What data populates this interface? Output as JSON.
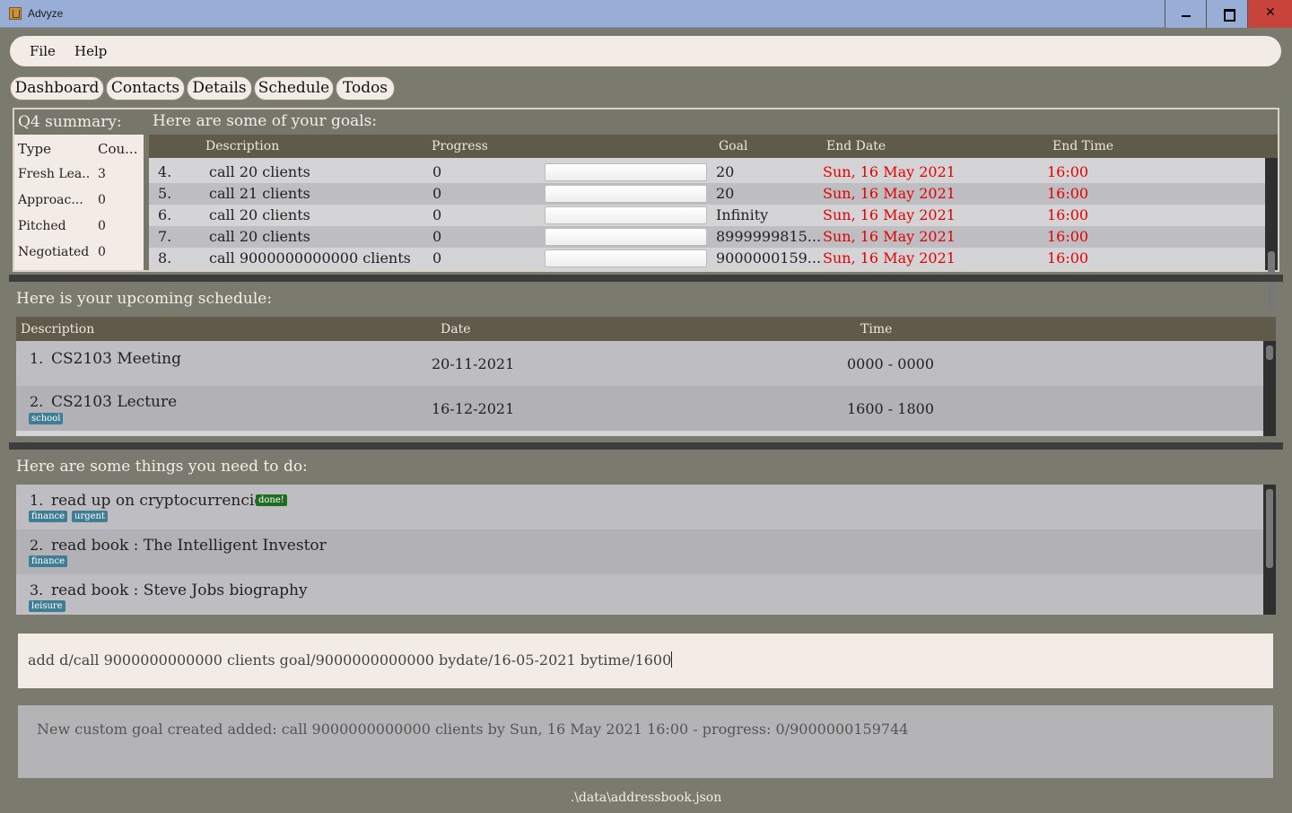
{
  "window": {
    "title": "Advyze",
    "close_glyph": "✕"
  },
  "menu": {
    "file": "File",
    "help": "Help"
  },
  "tabs": [
    "Dashboard",
    "Contacts",
    "Details",
    "Schedule",
    "Todos"
  ],
  "summary": {
    "title": "Q4 summary:",
    "columns": [
      "Type",
      "Cou..."
    ],
    "rows": [
      {
        "type": "Fresh Lea...",
        "count": "3"
      },
      {
        "type": "Approac...",
        "count": "0"
      },
      {
        "type": "Pitched",
        "count": "0"
      },
      {
        "type": "Negotiated",
        "count": "0"
      }
    ]
  },
  "goals": {
    "title": "Here are some of your goals:",
    "columns": {
      "description": "Description",
      "progress": "Progress",
      "goal": "Goal",
      "end_date": "End Date",
      "end_time": "End Time"
    },
    "rows": [
      {
        "index": "4.",
        "description": "call 20 clients",
        "progress": "0",
        "progress_fraction": 0,
        "goal": "20",
        "end_date": "Sun, 16 May 2021",
        "end_time": "16:00"
      },
      {
        "index": "5.",
        "description": "call 21 clients",
        "progress": "0",
        "progress_fraction": 0,
        "goal": "20",
        "end_date": "Sun, 16 May 2021",
        "end_time": "16:00"
      },
      {
        "index": "6.",
        "description": "call 20 clients",
        "progress": "0",
        "progress_fraction": 0,
        "goal": "Infinity",
        "end_date": "Sun, 16 May 2021",
        "end_time": "16:00"
      },
      {
        "index": "7.",
        "description": "call 20 clients",
        "progress": "0",
        "progress_fraction": 0,
        "goal": "8999999815...",
        "end_date": "Sun, 16 May 2021",
        "end_time": "16:00"
      },
      {
        "index": "8.",
        "description": "call 9000000000000 clients",
        "progress": "0",
        "progress_fraction": 0,
        "goal": "9000000159...",
        "end_date": "Sun, 16 May 2021",
        "end_time": "16:00"
      }
    ]
  },
  "schedule": {
    "title": "Here is your upcoming schedule:",
    "columns": {
      "description": "Description",
      "date": "Date",
      "time": "Time"
    },
    "rows": [
      {
        "index": "1.",
        "description": "CS2103 Meeting",
        "date": "20-11-2021",
        "time": "0000 - 0000",
        "tags": []
      },
      {
        "index": "2.",
        "description": "CS2103 Lecture",
        "date": "16-12-2021",
        "time": "1600 - 1800",
        "tags": [
          "school"
        ]
      }
    ]
  },
  "todos": {
    "title": "Here are some things you need to do:",
    "rows": [
      {
        "index": "1.",
        "text": "read up on cryptocurrencies",
        "done_label": "done!",
        "tags": [
          "finance",
          "urgent"
        ]
      },
      {
        "index": "2.",
        "text": "read book : The Intelligent Investor",
        "done_label": "",
        "tags": [
          "finance"
        ]
      },
      {
        "index": "3.",
        "text": "read book : Steve Jobs biography",
        "done_label": "",
        "tags": [
          "leisure"
        ]
      }
    ]
  },
  "command": {
    "value": "add d/call 9000000000000 clients goal/9000000000000 bydate/16-05-2021 bytime/1600"
  },
  "result": {
    "text": "New custom goal created added: call 9000000000000 clients by Sun, 16 May 2021 16:00 - progress: 0/9000000159744"
  },
  "status": {
    "path": ".\\data\\addressbook.json"
  },
  "colors": {
    "accent_red": "#e30000",
    "tag_blue": "#3e7d93",
    "tag_done": "#1f6b1f",
    "header_bg": "#5f5a4a"
  }
}
